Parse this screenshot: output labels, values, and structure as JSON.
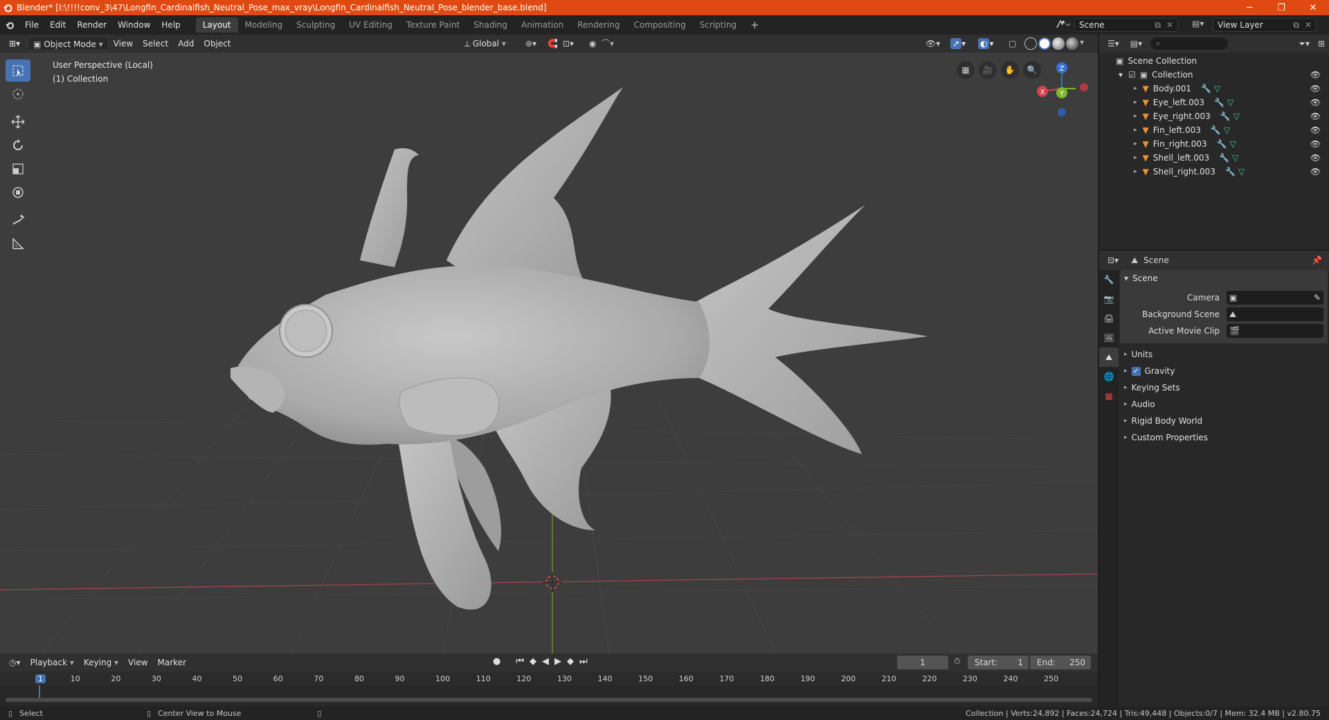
{
  "window": {
    "title": "Blender* [I:\\!!!!conv_3\\47\\Longfin_Cardinalfish_Neutral_Pose_max_vray\\Longfin_Cardinalfish_Neutral_Pose_blender_base.blend]",
    "controls": [
      "─",
      "❐",
      "✕"
    ]
  },
  "menu": [
    "File",
    "Edit",
    "Render",
    "Window",
    "Help"
  ],
  "workspaces": [
    {
      "label": "Layout",
      "active": true
    },
    {
      "label": "Modeling"
    },
    {
      "label": "Sculpting"
    },
    {
      "label": "UV Editing"
    },
    {
      "label": "Texture Paint"
    },
    {
      "label": "Shading"
    },
    {
      "label": "Animation"
    },
    {
      "label": "Rendering"
    },
    {
      "label": "Compositing"
    },
    {
      "label": "Scripting"
    }
  ],
  "add_workspace": "+",
  "scene_field": "Scene",
  "view_layer_field": "View Layer",
  "viewport_header": {
    "mode": "Object Mode",
    "menus": [
      "View",
      "Select",
      "Add",
      "Object"
    ],
    "transform_orientation": "Global"
  },
  "viewport": {
    "perspective": "User Perspective (Local)",
    "collection": "(1) Collection",
    "gizmo": {
      "x": "X",
      "y": "Y",
      "z": "Z"
    }
  },
  "timeline_header": {
    "menus": [
      "Playback",
      "Keying",
      "View",
      "Marker"
    ],
    "current_frame": "1",
    "start_label": "Start:",
    "start_value": "1",
    "end_label": "End:",
    "end_value": "250"
  },
  "timeline": {
    "ticks": [
      "1",
      "10",
      "20",
      "30",
      "40",
      "50",
      "60",
      "70",
      "80",
      "90",
      "100",
      "110",
      "120",
      "130",
      "140",
      "150",
      "160",
      "170",
      "180",
      "190",
      "200",
      "210",
      "220",
      "230",
      "240",
      "250"
    ]
  },
  "outliner": {
    "root": "Scene Collection",
    "collection": "Collection",
    "items": [
      "Body.001",
      "Eye_left.003",
      "Eye_right.003",
      "Fin_left.003",
      "Fin_right.003",
      "Shell_left.003",
      "Shell_right.003"
    ]
  },
  "properties": {
    "header_title": "Scene",
    "section": "Scene",
    "fields": [
      {
        "label": "Camera",
        "value": ""
      },
      {
        "label": "Background Scene",
        "value": ""
      },
      {
        "label": "Active Movie Clip",
        "value": ""
      }
    ],
    "subsections": [
      {
        "label": "Units",
        "checkbox": false
      },
      {
        "label": "Gravity",
        "checkbox": true
      },
      {
        "label": "Keying Sets",
        "checkbox": false
      },
      {
        "label": "Audio",
        "checkbox": false
      },
      {
        "label": "Rigid Body World",
        "checkbox": false
      },
      {
        "label": "Custom Properties",
        "checkbox": false
      }
    ]
  },
  "statusbar": {
    "select": "Select",
    "center_view": "Center View to Mouse",
    "stats": "Collection | Verts:24,892 | Faces:24,724 | Tris:49,448 | Objects:0/7 | Mem: 32.4 MB | v2.80.75"
  },
  "colors": {
    "titlebar": "#e04a12",
    "accent": "#4772b3",
    "object_icon": "#e8923a",
    "mesh_icon": "#3cc9a0",
    "modifier_icon": "#6aa6e8"
  }
}
